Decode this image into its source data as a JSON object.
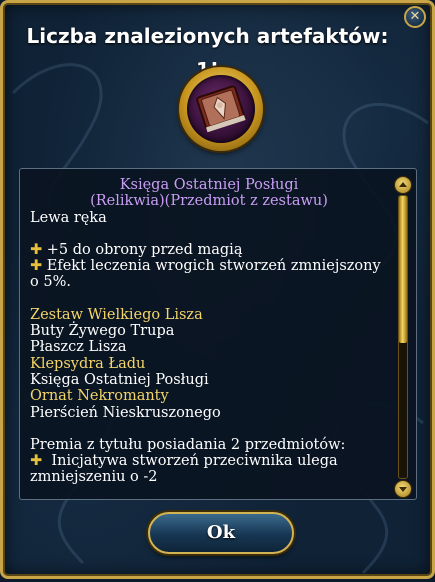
{
  "dialog": {
    "title": "Liczba znalezionych artefaktów: 1!",
    "close_glyph": "✕"
  },
  "artifact": {
    "icon": "book-artifact-icon",
    "name": "Księga Ostatniej Posługi",
    "type": "(Relikwia)(Przedmiot z zestawu)",
    "slot": "Lewa ręka",
    "bonuses": [
      "+5 do obrony przed magią",
      "Efekt leczenia wrogich stworzeń zmniejszony",
      "o 5%."
    ],
    "set": {
      "name": "Zestaw Wielkiego Lisza",
      "items": [
        {
          "label": "Buty Żywego Trupa",
          "owned": false
        },
        {
          "label": "Płaszcz Lisza",
          "owned": false
        },
        {
          "label": "Klepsydra Ładu",
          "owned": true
        },
        {
          "label": "Księga Ostatniej Posługi",
          "owned": false
        },
        {
          "label": "Ornat Nekromanty",
          "owned": true
        },
        {
          "label": "Pierścień Nieskruszonego",
          "owned": false
        }
      ]
    },
    "set_bonus": {
      "header": "Premia z tytułu posiadania 2 przedmiotów:",
      "lines": [
        "Inicjatywa stworzeń przeciwnika ulega",
        "zmniejszeniu o -2"
      ]
    }
  },
  "scroll": {
    "position": 0.0,
    "visible_fraction": 0.52
  },
  "ok_label": "Ok",
  "colors": {
    "frame_gold": "#c8a648",
    "item_name": "#c99ef3",
    "set_item_owned": "#f4d56a",
    "text": "#ffffff",
    "background": "#0f2236"
  }
}
